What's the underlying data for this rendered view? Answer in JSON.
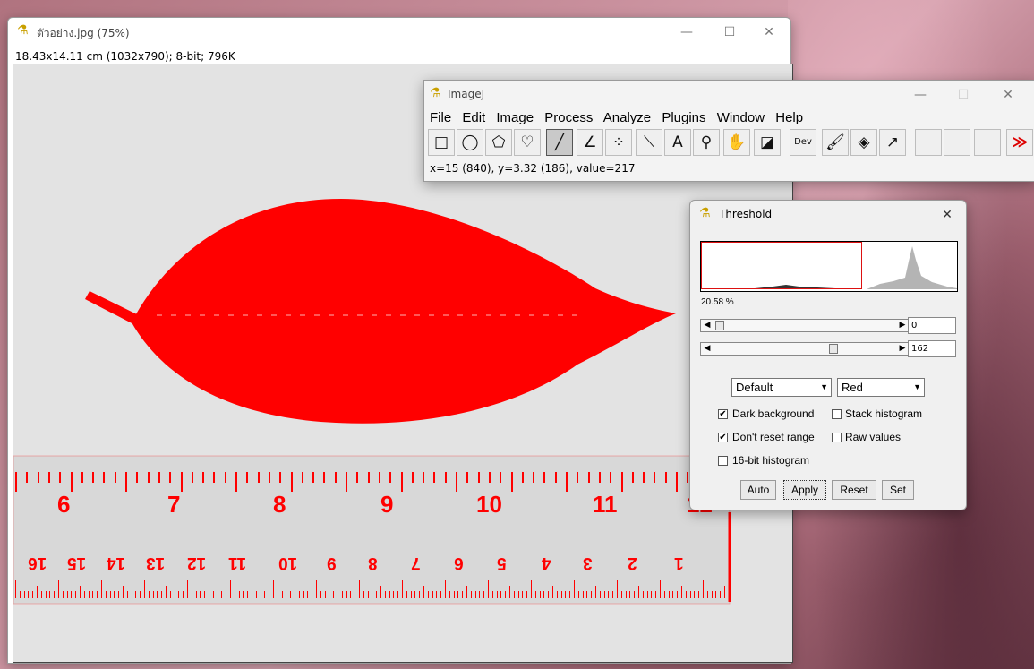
{
  "image_window": {
    "title": "ตัวอย่าง.jpg (75%)",
    "info": "18.43x14.11 cm (1032x790); 8-bit; 796K",
    "ruler_top_numbers": [
      "6",
      "7",
      "8",
      "9",
      "10",
      "11",
      "12"
    ],
    "ruler_bottom_numbers": [
      "16",
      "15",
      "14",
      "13",
      "12",
      "11",
      "10",
      "9",
      "8",
      "7",
      "6",
      "5",
      "4",
      "3",
      "2",
      "1"
    ]
  },
  "imagej": {
    "title": "ImageJ",
    "menu": [
      "File",
      "Edit",
      "Image",
      "Process",
      "Analyze",
      "Plugins",
      "Window",
      "Help"
    ],
    "tools": [
      {
        "name": "rectangle-tool",
        "glyph": "□"
      },
      {
        "name": "oval-tool",
        "glyph": "◯"
      },
      {
        "name": "polygon-tool",
        "glyph": "⬠"
      },
      {
        "name": "freehand-tool",
        "glyph": "♡"
      },
      {
        "name": "line-tool",
        "glyph": "╱"
      },
      {
        "name": "angle-tool",
        "glyph": "∠"
      },
      {
        "name": "point-tool",
        "glyph": "⁘"
      },
      {
        "name": "wand-tool",
        "glyph": "⟍"
      },
      {
        "name": "text-tool",
        "glyph": "A"
      },
      {
        "name": "magnifier-tool",
        "glyph": "⚲"
      },
      {
        "name": "hand-tool",
        "glyph": "✋"
      },
      {
        "name": "color-picker-tool",
        "glyph": "◪"
      },
      {
        "name": "developer-menu",
        "glyph": "Dev"
      },
      {
        "name": "brush-tool",
        "glyph": "🖌"
      },
      {
        "name": "flood-fill-tool",
        "glyph": "◈"
      },
      {
        "name": "arrow-tool",
        "glyph": "↗"
      },
      {
        "name": "empty-slot-1",
        "glyph": ""
      },
      {
        "name": "empty-slot-2",
        "glyph": ""
      },
      {
        "name": "empty-slot-3",
        "glyph": ""
      },
      {
        "name": "more-tools",
        "glyph": "≫"
      }
    ],
    "status": "x=15 (840), y=3.32 (186), value=217"
  },
  "threshold": {
    "title": "Threshold",
    "percent": "20.58 %",
    "min_value": "0",
    "max_value": "162",
    "method": "Default",
    "display_mode": "Red",
    "options": [
      {
        "label": "Dark background",
        "checked": true
      },
      {
        "label": "Stack histogram",
        "checked": false
      },
      {
        "label": "Don't reset range",
        "checked": true
      },
      {
        "label": "Raw values",
        "checked": false
      },
      {
        "label": "16-bit histogram",
        "checked": false
      }
    ],
    "buttons": [
      "Auto",
      "Apply",
      "Reset",
      "Set"
    ],
    "colors": {
      "threshold_red": "#ff0000",
      "histogram_gray": "#b4b4b4"
    }
  }
}
